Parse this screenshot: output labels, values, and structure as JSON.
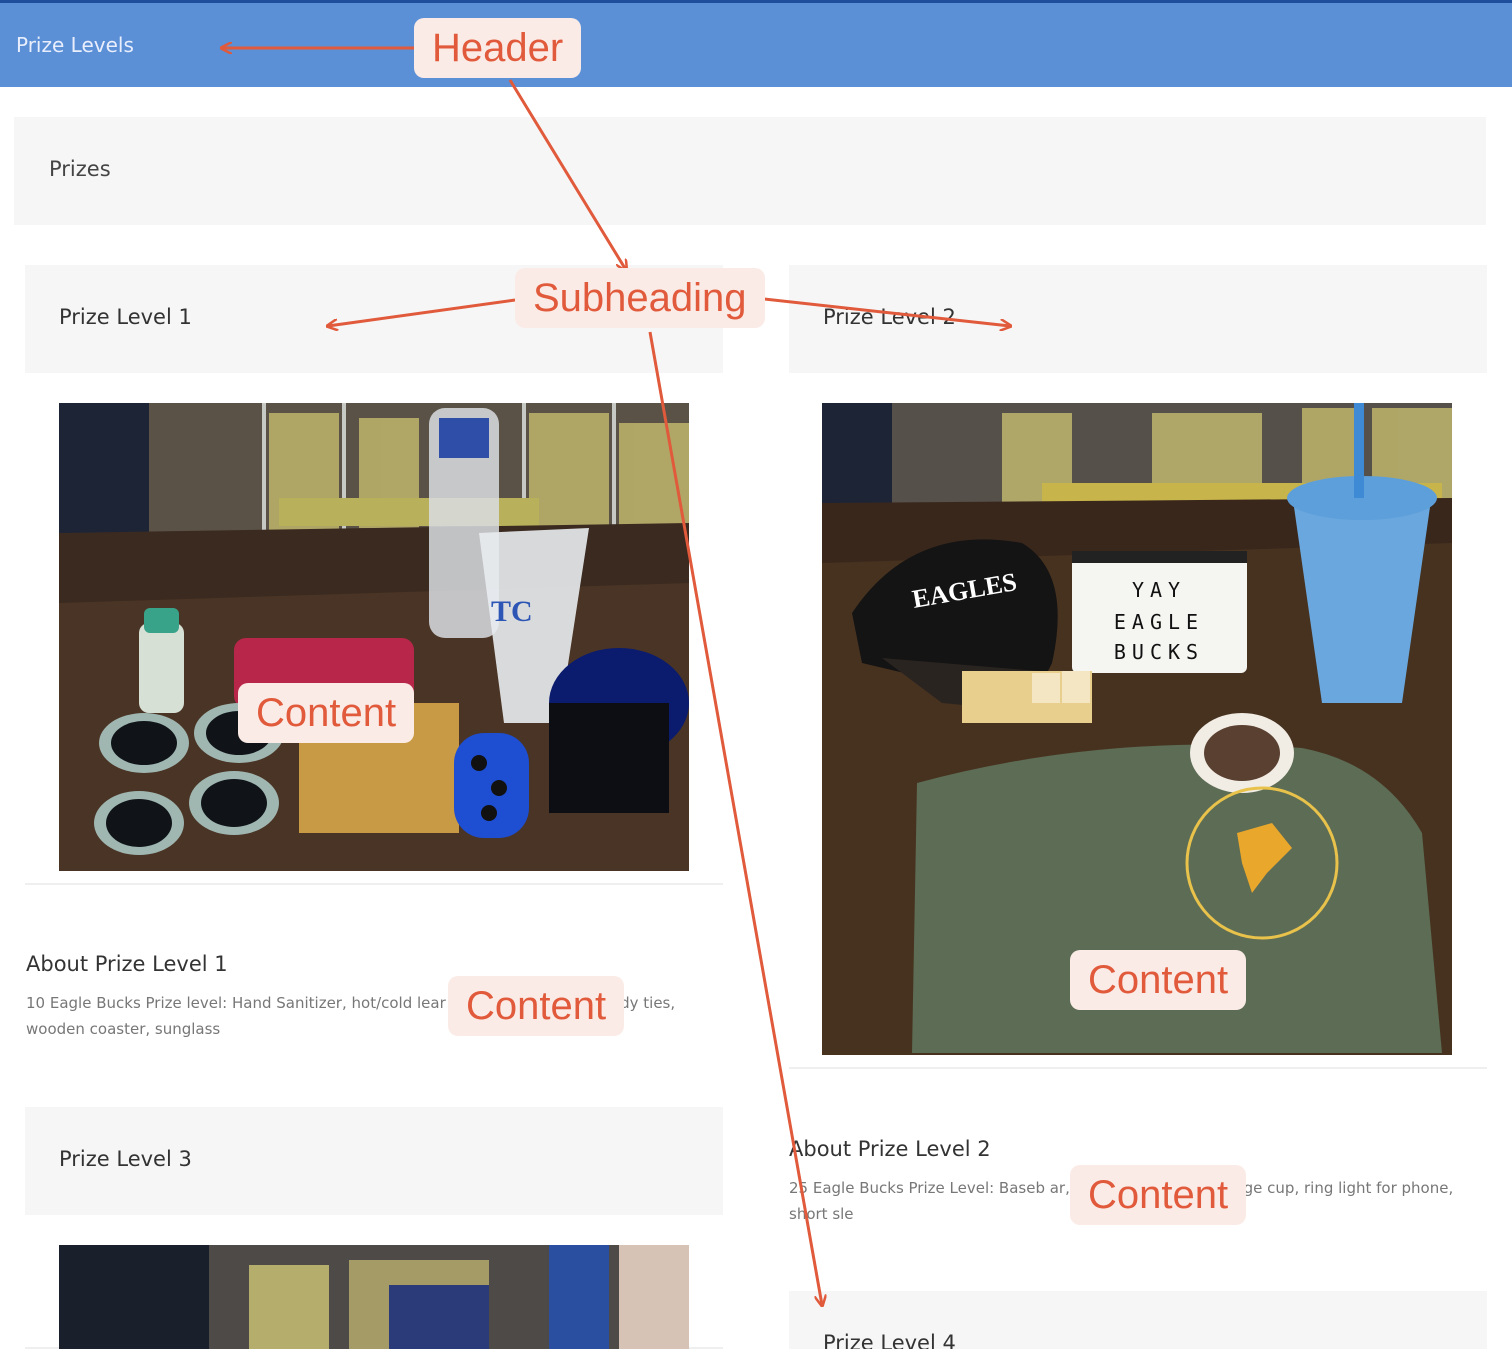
{
  "header": {
    "title": "Prize Levels"
  },
  "section": {
    "title": "Prizes"
  },
  "levels": [
    {
      "title": "Prize Level 1",
      "about_title": "About Prize Level 1",
      "about_text": "10 Eagle Bucks Prize level: Hand Sanitizer, hot/cold lear cup, car trash can, toddy ties, wooden coaster, sunglass"
    },
    {
      "title": "Prize Level 2",
      "about_title": "About Prize Level 2",
      "about_text": "25 Eagle Bucks Prize Level: Baseb ar, light board, color change cup, ring light for phone, short sle"
    },
    {
      "title": "Prize Level 3"
    },
    {
      "title": "Prize Level 4"
    }
  ],
  "photos": {
    "level2_lightboard": [
      "YAY",
      "EAGLE",
      "BUCKS"
    ],
    "level2_cap": "EAGLES",
    "level1_cup": "TC"
  },
  "annotations": {
    "header": "Header",
    "subheading": "Subheading",
    "content1": "Content",
    "content2": "Content",
    "content3": "Content",
    "content4": "Content"
  },
  "colors": {
    "header_bg": "#5b8fd6",
    "panel_bg": "#f6f6f6",
    "annotation": "#e05a3b",
    "annotation_bg": "#fbebe6"
  }
}
